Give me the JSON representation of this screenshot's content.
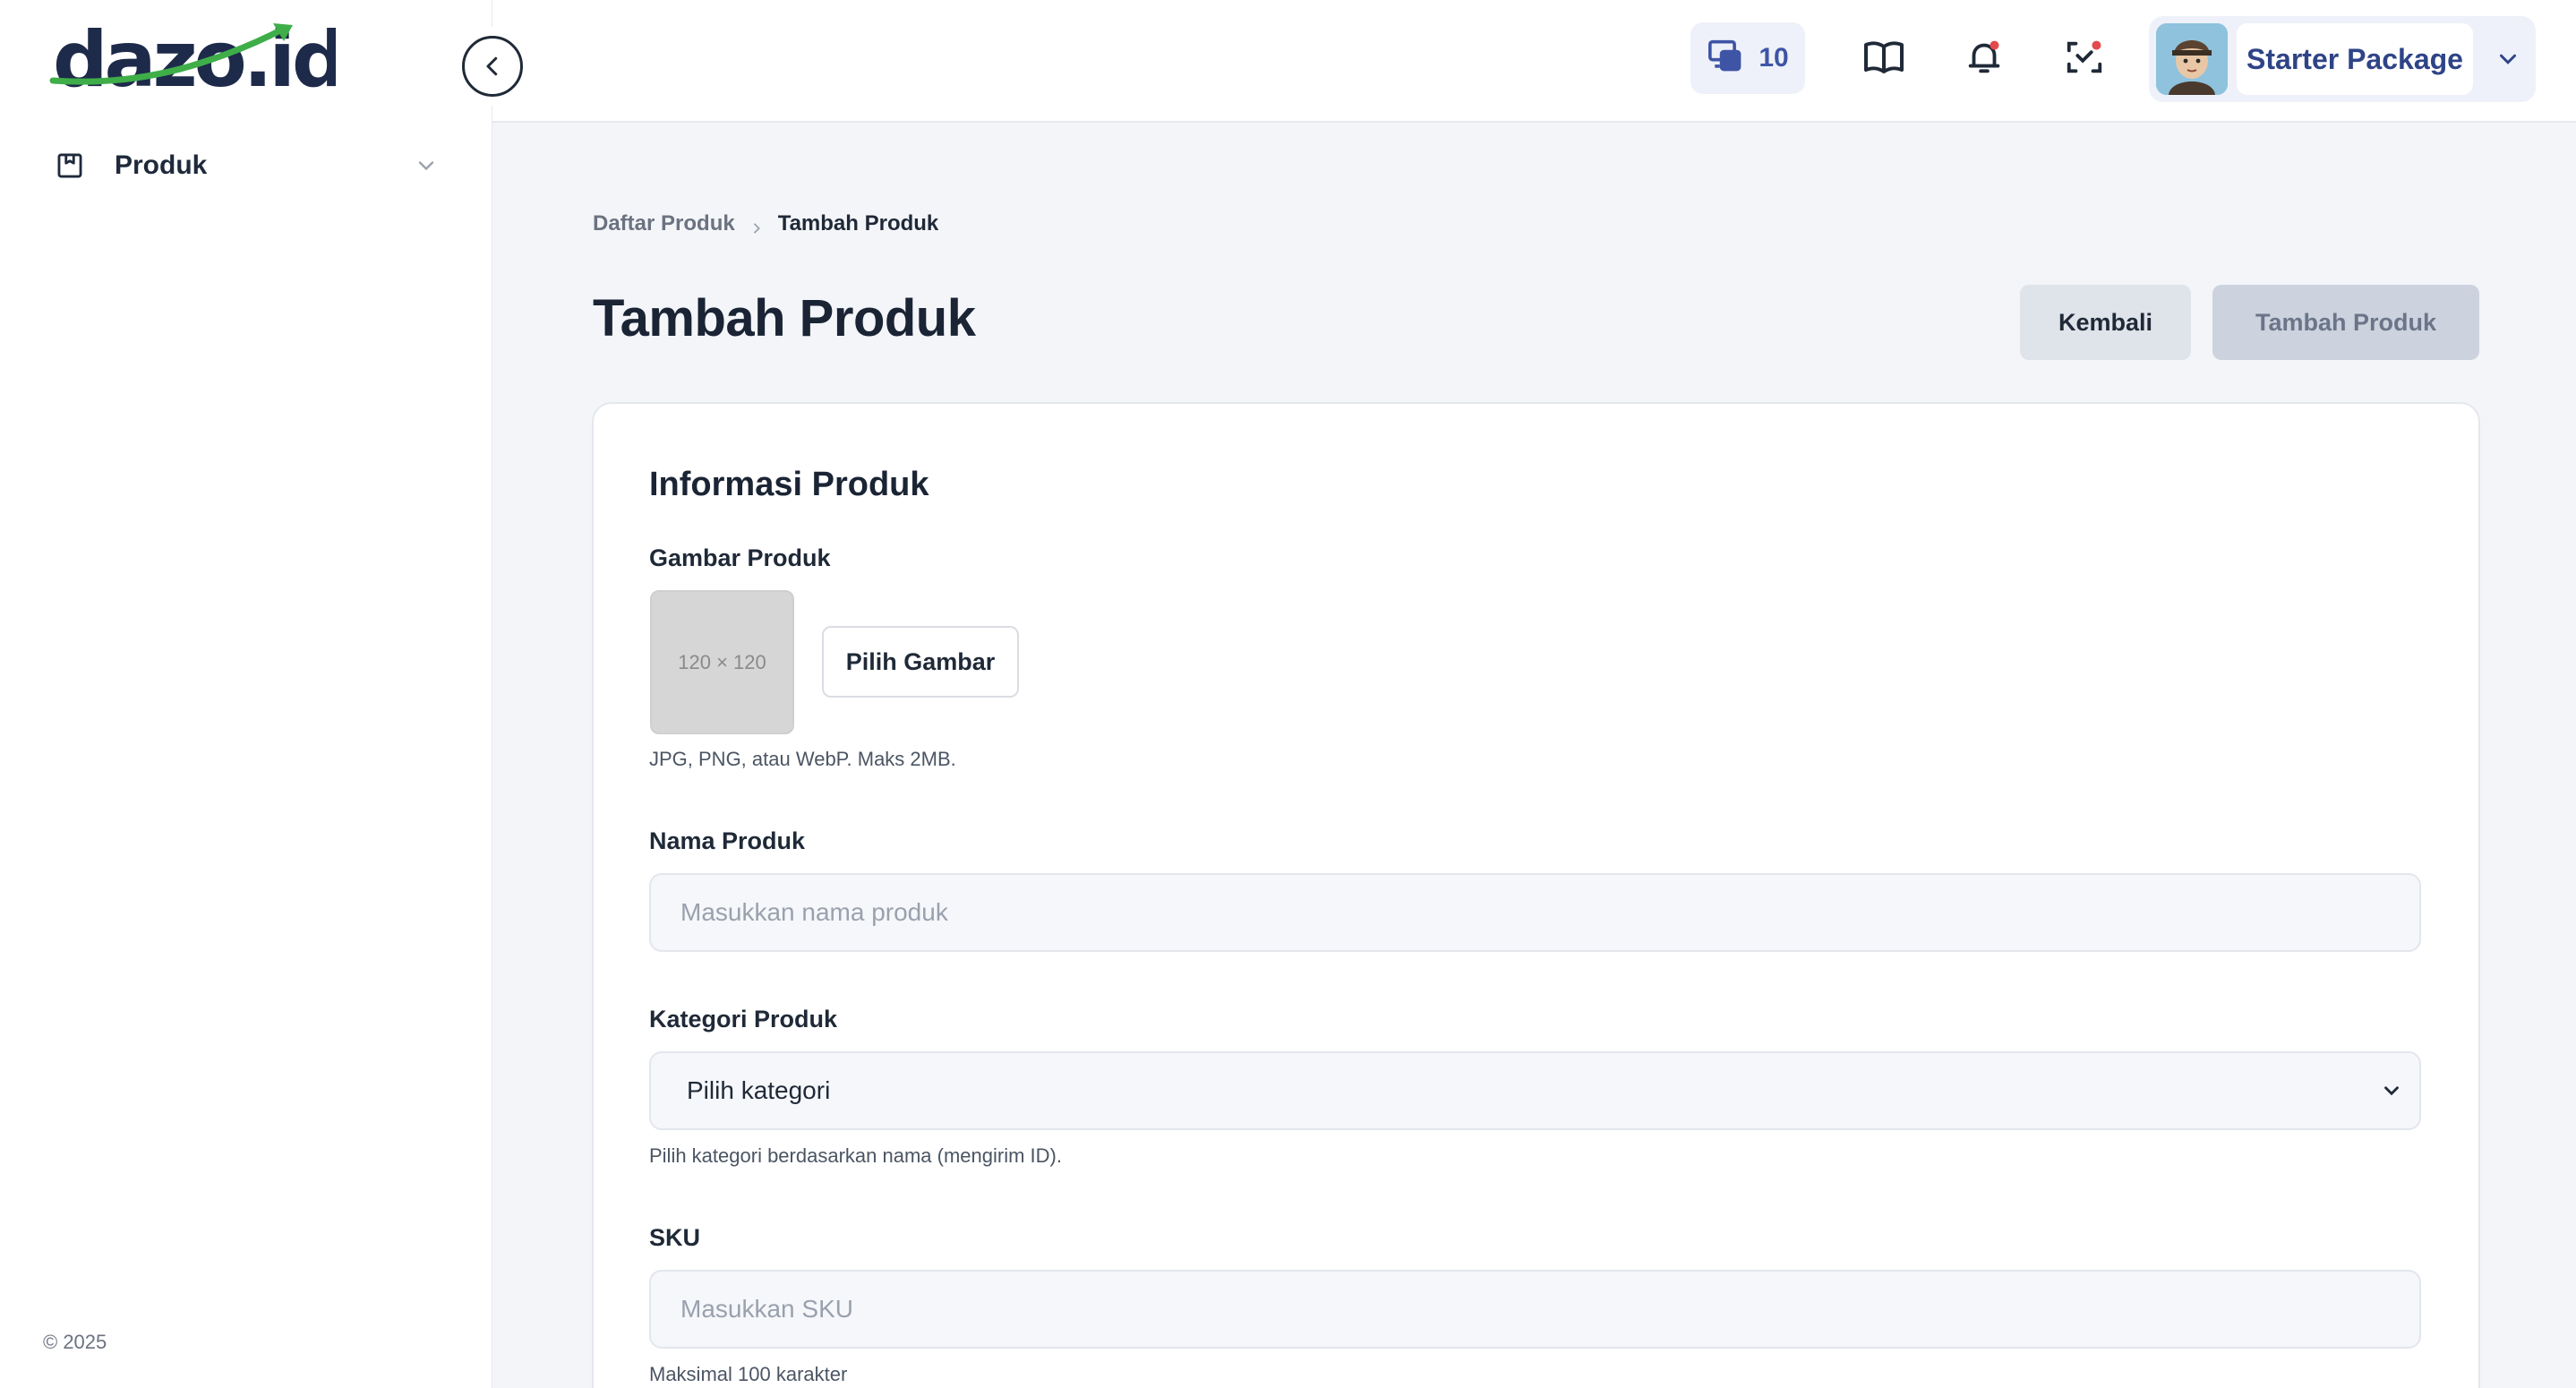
{
  "brand": {
    "logo_text": "dazo.id",
    "accent": "#3fae49",
    "navy": "#1e2a4a"
  },
  "sidebar": {
    "items": [
      {
        "label": "Produk",
        "icon": "box-icon",
        "expanded": false
      }
    ],
    "copyright": "© 2025"
  },
  "topbar": {
    "credits": "10",
    "icons": [
      "device-credit-icon",
      "book-icon",
      "bell-icon",
      "scan-icon"
    ],
    "account": {
      "plan": "Starter Package",
      "avatar": "avatar"
    }
  },
  "breadcrumb": {
    "parent": "Daftar Produk",
    "current": "Tambah Produk"
  },
  "page": {
    "title": "Tambah Produk",
    "back_label": "Kembali",
    "submit_label": "Tambah Produk"
  },
  "form": {
    "section_title": "Informasi Produk",
    "image": {
      "label": "Gambar Produk",
      "placeholder_text": "120 × 120",
      "pick_label": "Pilih Gambar",
      "help": "JPG, PNG, atau WebP. Maks 2MB."
    },
    "name": {
      "label": "Nama Produk",
      "placeholder": "Masukkan nama produk",
      "value": ""
    },
    "category": {
      "label": "Kategori Produk",
      "selected": "Pilih kategori",
      "help": "Pilih kategori berdasarkan nama (mengirim ID)."
    },
    "sku": {
      "label": "SKU",
      "placeholder": "Masukkan SKU",
      "value": "",
      "help": "Maksimal 100 karakter"
    }
  }
}
